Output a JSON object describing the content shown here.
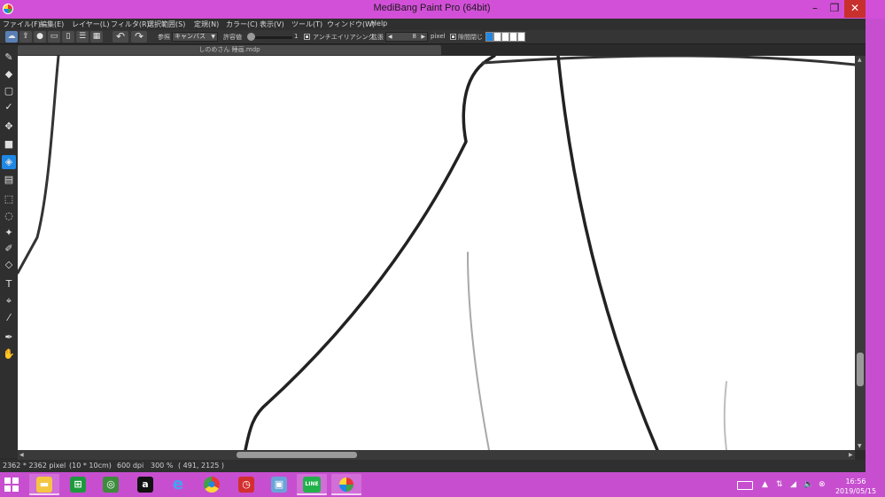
{
  "window": {
    "title": "MediBang Paint Pro (64bit)",
    "minimize_glyph": "–",
    "maximize_glyph": "❐",
    "close_glyph": "✕"
  },
  "menu": [
    {
      "label": "ファイル(F)"
    },
    {
      "label": "編集(E)"
    },
    {
      "label": "レイヤー(L)"
    },
    {
      "label": "フィルタ(R)"
    },
    {
      "label": "選択範囲(S)"
    },
    {
      "label": "定規(N)"
    },
    {
      "label": "カラー(C)"
    },
    {
      "label": "表示(V)"
    },
    {
      "label": "ツール(T)"
    },
    {
      "label": "ウィンドウ(W)"
    },
    {
      "label": "Help"
    }
  ],
  "toolbar": {
    "icons": [
      "cloud-icon",
      "share-icon",
      "comment-icon",
      "note-icon",
      "page-icon",
      "list-icon",
      "grid-icon"
    ],
    "undo_glyph": "↶",
    "redo_glyph": "↷",
    "reference_label": "参照",
    "reference_value": "キャンバス",
    "tolerance_label": "許容値",
    "tolerance_value": "1",
    "antialias_label": "アンチエイリアシング",
    "expand_label": "拡張",
    "expand_value": "8",
    "expand_unit": "pixel",
    "close_gap_label": "隙間閉じ",
    "close_gap_fraction": 0.2
  },
  "document": {
    "tab_title": "しのめさん 睡画.mdp"
  },
  "tools": [
    {
      "name": "brush-icon",
      "glyph": "✎",
      "active": false
    },
    {
      "name": "eraser-icon",
      "glyph": "◆",
      "active": false
    },
    {
      "name": "rect-shape-icon",
      "glyph": "▢",
      "active": false
    },
    {
      "name": "dot-brush-icon",
      "glyph": "✓",
      "active": false
    },
    {
      "name": "move-icon",
      "glyph": "✥",
      "active": false
    },
    {
      "name": "fill-rect-icon",
      "glyph": "■",
      "active": false
    },
    {
      "name": "bucket-icon",
      "glyph": "◈",
      "active": true
    },
    {
      "name": "gradient-icon",
      "glyph": "▤",
      "active": false
    },
    {
      "name": "select-rect-icon",
      "glyph": "⬚",
      "active": false
    },
    {
      "name": "lasso-icon",
      "glyph": "◌",
      "active": false
    },
    {
      "name": "magic-wand-icon",
      "glyph": "✦",
      "active": false
    },
    {
      "name": "select-pen-icon",
      "glyph": "✐",
      "active": false
    },
    {
      "name": "select-eraser-icon",
      "glyph": "◇",
      "active": false
    },
    {
      "name": "text-icon",
      "glyph": "T",
      "active": false
    },
    {
      "name": "operation-icon",
      "glyph": "⌖",
      "active": false
    },
    {
      "name": "eyedropper-icon",
      "glyph": "⁄",
      "active": false
    },
    {
      "name": "pen-icon",
      "glyph": "✒",
      "active": false
    },
    {
      "name": "hand-icon",
      "glyph": "✋",
      "active": false
    }
  ],
  "status": {
    "size": "2362 * 2362 pixel",
    "physical": "(10 * 10cm)",
    "dpi": "600 dpi",
    "zoom": "300 %",
    "cursor": "( 491, 2125 )"
  },
  "taskbar": {
    "apps": [
      {
        "name": "file-explorer-icon",
        "glyph": "▬",
        "color": "#f4c542",
        "open": true
      },
      {
        "name": "store-icon",
        "glyph": "⊞",
        "color": "#1c9a3d",
        "open": false
      },
      {
        "name": "network-app-icon",
        "glyph": "◎",
        "color": "#3c8c3c",
        "open": false
      },
      {
        "name": "amazon-icon",
        "glyph": "a",
        "color": "#111111",
        "open": false
      },
      {
        "name": "internet-explorer-icon",
        "glyph": "e",
        "color": "#1e88e5",
        "open": false
      },
      {
        "name": "chrome-icon",
        "glyph": "●",
        "color": "#e53935",
        "open": false
      },
      {
        "name": "alarm-clock-icon",
        "glyph": "◷",
        "color": "#d32f2f",
        "open": false
      },
      {
        "name": "remote-desktop-icon",
        "glyph": "▣",
        "color": "#6aa3d8",
        "open": false
      },
      {
        "name": "line-icon",
        "glyph": "LINE",
        "color": "#21b24b",
        "open": true
      },
      {
        "name": "medibang-icon",
        "glyph": "●",
        "color": "#ffffff",
        "open": true
      }
    ],
    "time": "16:56",
    "date": "2019/05/15"
  }
}
